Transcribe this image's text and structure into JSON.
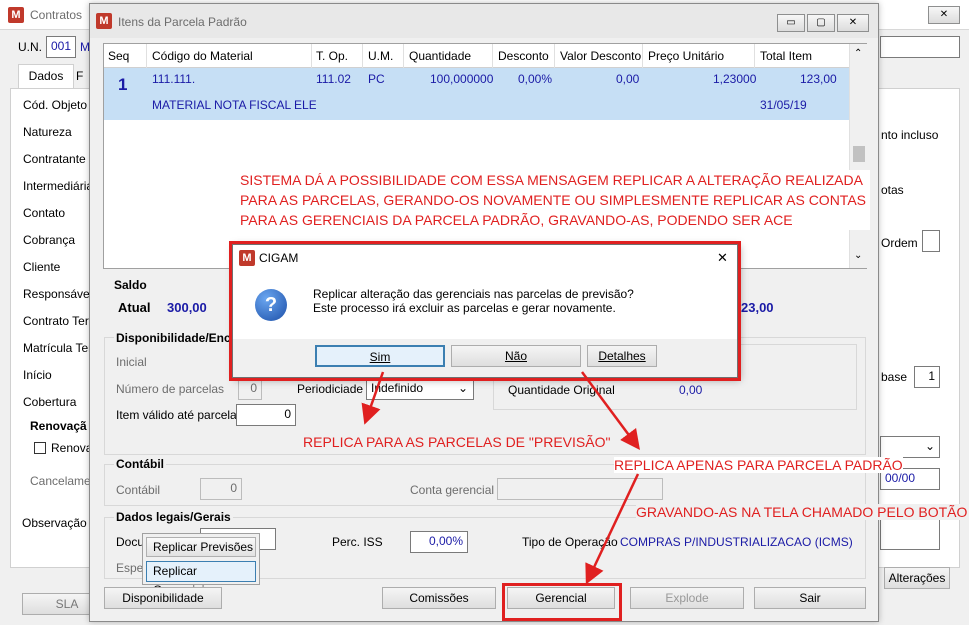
{
  "main_window": {
    "title": "Contratos",
    "un_label": "U.N.",
    "un_value": "001",
    "un_extra": "MC",
    "tab_dados": "Dados",
    "tab_f": "F",
    "fields": [
      "Cód. Objeto",
      "Natureza",
      "Contratante",
      "Intermediária",
      "Contato",
      "Cobrança",
      "Cliente",
      "Responsável",
      "Contrato Terc",
      "Matrícula Terc",
      "Início",
      "Cobertura"
    ],
    "renovacao_label": "Renovaçã",
    "renova_check": "Renova",
    "cancelamento": "Cancelamen",
    "observacao": "Observação",
    "sla_button": "SLA",
    "right_texto_incluso": "nto incluso",
    "right_notas": "otas",
    "right_ordem": "Ordem",
    "right_base": "base",
    "right_base_value": "1",
    "right_date": "00/00",
    "alteracoes_button": "Alterações",
    "close_glyph": "✕"
  },
  "items_window": {
    "title": "Itens da Parcela Padrão",
    "columns": [
      "Seq",
      "Código do Material",
      "T. Op.",
      "U.M.",
      "Quantidade",
      "Desconto",
      "Valor Desconto",
      "Preço Unitário",
      "Total Item"
    ],
    "row": {
      "seq": "1",
      "codigo": "111.111.",
      "top": "111.02",
      "um": "PC",
      "quantidade": "100,000000",
      "desconto": "0,00%",
      "valor_desconto": "0,00",
      "preco_unitario": "1,23000",
      "total_item": "123,00",
      "descricao": "MATERIAL NOTA FISCAL ELETRÔ",
      "data": "31/05/19"
    },
    "saldo_label": "Saldo",
    "atual_label": "Atual",
    "atual_value": "300,00",
    "saldo_right_value": "23,00",
    "disponibilidade_group": "Disponibilidade/Enc",
    "inicial_label": "Inicial",
    "numero_parcelas_label": "Número de parcelas",
    "numero_parcelas_value": "0",
    "periodicidade_label": "Periodiciade",
    "periodicidade_value": "Indefinido",
    "quantidade_original_label": "Quantidade Original",
    "quantidade_original_value": "0,00",
    "item_valido_label": "Item válido até parcela",
    "item_valido_value": "0",
    "contabil_group": "Contábil",
    "contabil_label": "Contábil",
    "contabil_value": "0",
    "conta_gerencial_label": "Conta gerencial",
    "dados_legais_group": "Dados legais/Gerais",
    "docum_label": "Docur",
    "espec_label": "Espec",
    "perc_iss_label": "Perc. ISS",
    "perc_iss_value": "0,00%",
    "tipo_operacao_label": "Tipo de Operação",
    "tipo_operacao_value": "COMPRAS P/INDUSTRIALIZACAO (ICMS)",
    "menu_replicar_previsoes": "Replicar Previsões",
    "menu_replicar_gerenciais": "Replicar Gerenciais",
    "btn_disponibilidade": "Disponibilidade",
    "btn_comissoes": "Comissões",
    "btn_gerencial": "Gerencial",
    "btn_explode": "Explode",
    "btn_sair": "Sair",
    "minimize_glyph": "▭",
    "maximize_glyph": "▢",
    "close_glyph": "✕"
  },
  "dialog": {
    "title": "CIGAM",
    "line1": "Replicar alteração das gerenciais nas parcelas de previsão?",
    "line2": "Este processo irá excluir as parcelas e gerar novamente.",
    "btn_sim": "Sim",
    "btn_nao": "Não",
    "btn_detalhes": "Detalhes",
    "question_glyph": "?",
    "close_glyph": "✕"
  },
  "annotations": {
    "top_text_1": "SISTEMA DÁ A POSSIBILIDADE COM ESSA MENSAGEM REPLICAR A ALTERAÇÃO REALIZADA",
    "top_text_2": "PARA AS PARCELAS, GERANDO-OS NOVAMENTE OU SIMPLESMENTE REPLICAR AS CONTAS",
    "top_text_3": "PARA AS GERENCIAIS DA PARCELA PADRÃO, GRAVANDO-AS, PODENDO SER ACE",
    "replica_previsao": "REPLICA PARA AS PARCELAS DE \"PREVISÃO\"",
    "replica_padrao": "REPLICA APENAS PARA PARCELA PADRÃO",
    "gravando": "GRAVANDO-AS NA TELA CHAMADO PELO BOTÃO",
    "color": "#e02020"
  },
  "logo_letter": "M"
}
